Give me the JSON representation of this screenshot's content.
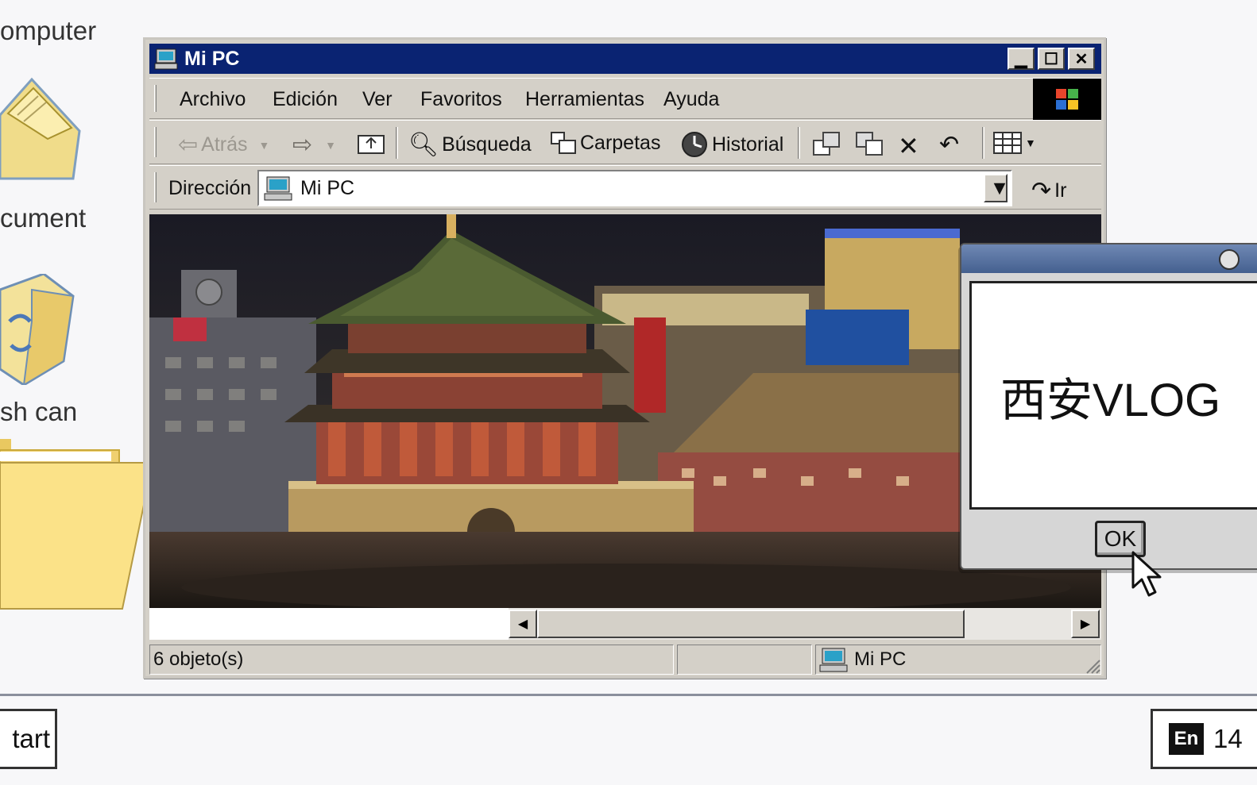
{
  "desktop": {
    "icons": [
      {
        "label": "omputer"
      },
      {
        "label": "cument"
      },
      {
        "label": "sh can"
      }
    ]
  },
  "window": {
    "title": "Mi PC",
    "menu": [
      "Archivo",
      "Edición",
      "Ver",
      "Favoritos",
      "Herramientas",
      "Ayuda"
    ],
    "toolbar": {
      "back": "Atrás",
      "search": "Búsqueda",
      "folders": "Carpetas",
      "history": "Historial"
    },
    "address": {
      "label": "Dirección",
      "value": "Mi PC",
      "go": "Ir"
    },
    "status": {
      "objects": "6 objeto(s)",
      "location": "Mi PC"
    }
  },
  "dialog": {
    "message": "西安VLOG",
    "ok_label": "OK"
  },
  "taskbar": {
    "start_label": "tart",
    "lang": "En",
    "clock": "14"
  },
  "colors": {
    "titlebar": "#0a2372",
    "chrome": "#d4d0c8",
    "desktop": "#f7f7f9",
    "dialog_title": "#5a74a2"
  }
}
